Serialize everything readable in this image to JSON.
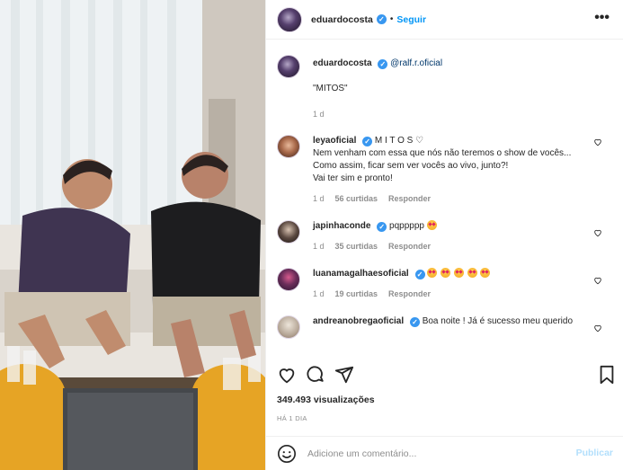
{
  "post": {
    "username": "eduardocosta",
    "follow_label": "Seguir",
    "more_label": "•••"
  },
  "caption": {
    "username": "eduardocosta",
    "mention": "@ralf.r.oficial",
    "text": "\"MITOS\"",
    "age": "1 d"
  },
  "comments": [
    {
      "username": "leyaoficial",
      "lines": [
        "M I T O S ♡",
        "Nem venham com essa que nós não teremos o show de vocês...",
        "Como assim, ficar sem ver vocês ao vivo, junto?!",
        "Vai ter sim e pronto!"
      ],
      "age": "1 d",
      "likes": "56 curtidas",
      "reply": "Responder"
    },
    {
      "username": "japinhaconde",
      "text": "pqppppp",
      "age": "1 d",
      "likes": "35 curtidas",
      "reply": "Responder"
    },
    {
      "username": "luanamagalhaesoficial",
      "text": "",
      "age": "1 d",
      "likes": "19 curtidas",
      "reply": "Responder"
    },
    {
      "username": "andreanobregaoficial",
      "text": "Boa noite ! Já é sucesso meu querido"
    }
  ],
  "stats": {
    "views": "349.493 visualizações",
    "time": "HÁ 1 DIA"
  },
  "add_comment": {
    "placeholder": "Adicione um comentário...",
    "publish": "Publicar"
  },
  "icons": [
    "heart-icon",
    "comment-icon",
    "share-icon",
    "bookmark-icon",
    "smile-icon",
    "verified-icon",
    "more-icon"
  ],
  "colors": {
    "accent": "#0095f6",
    "verified": "#3897f0",
    "muted": "#8e8e8e",
    "publish_disabled": "#b2dffc"
  }
}
